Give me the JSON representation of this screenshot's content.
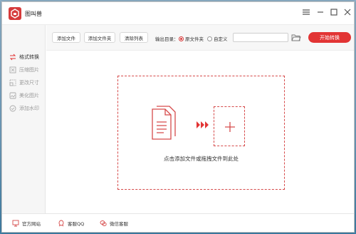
{
  "app": {
    "title": "图叫兽"
  },
  "window_controls": {
    "menu": "menu-icon",
    "minimize": "minimize-icon",
    "maximize": "maximize-icon",
    "close": "close-icon"
  },
  "sidebar": {
    "items": [
      {
        "label": "格式转换",
        "icon": "format-convert-icon",
        "active": true
      },
      {
        "label": "压缩图片",
        "icon": "compress-icon",
        "active": false
      },
      {
        "label": "更改尺寸",
        "icon": "resize-icon",
        "active": false
      },
      {
        "label": "美化图片",
        "icon": "beautify-icon",
        "active": false
      },
      {
        "label": "添加水印",
        "icon": "watermark-icon",
        "active": false
      }
    ]
  },
  "toolbar": {
    "add_file": "添加文件",
    "add_folder": "添加文件夹",
    "clear_list": "清除列表",
    "output_label": "输出目录：",
    "radio_original": "原文件夹",
    "radio_custom": "自定义",
    "selected_output": "原文件夹",
    "path_value": "",
    "path_placeholder": "",
    "start": "开始转换"
  },
  "dropzone": {
    "hint": "点击添加文件或拖拽文件到此处"
  },
  "footer": {
    "website": "官方网站",
    "qq": "客服QQ",
    "wechat": "微信客服"
  },
  "colors": {
    "accent": "#e23434",
    "dash": "#d64a4a"
  }
}
